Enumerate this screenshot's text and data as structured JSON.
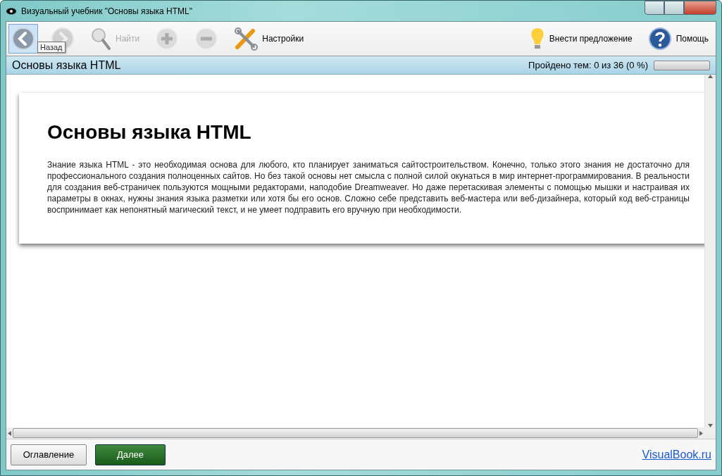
{
  "window": {
    "title": "Визуальный учебник \"Основы языка HTML\""
  },
  "toolbar": [
    {
      "kind": "back",
      "disabled": false,
      "hovered": true,
      "tooltip": "Назад"
    },
    {
      "kind": "forward",
      "disabled": true,
      "hovered": false
    },
    {
      "kind": "find",
      "label": "Найти",
      "disabled": true,
      "hovered": false
    },
    {
      "kind": "zoom-in",
      "disabled": true,
      "hovered": false
    },
    {
      "kind": "zoom-out",
      "disabled": true,
      "hovered": false
    },
    {
      "kind": "settings",
      "label": "Настройки",
      "disabled": false,
      "hovered": false
    },
    {
      "kind": "spacer"
    },
    {
      "kind": "suggest",
      "label": "Внести предложение",
      "disabled": false,
      "hovered": false
    },
    {
      "kind": "help",
      "label": "Помощь",
      "disabled": false,
      "hovered": false
    }
  ],
  "header": {
    "title": "Основы языка HTML",
    "progress_text": "Пройдено тем: 0 из 36 (0 %)",
    "level": 0
  },
  "article": {
    "heading": "Основы языка HTML",
    "paragraph": "Знание языка HTML - это необходимая основа для любого, кто планирует заниматься сайтостроительством. Конечно, только этого знания не достаточно для профессионального создания полноценных сайтов. Но без такой основы нет смысла с полной силой окунаться в мир интернет-программирования. В реальности для создания веб-страничек пользуются мощными редакторами, наподобие Dreamweaver. Но даже перетаскивая элементы с помощью мышки и настраивая их параметры в окнах, нужны знания языка разметки или хотя бы его основ. Сложно себе представить веб-мастера или веб-дизайнера, который код веб-страницы воспринимает как непонятный магический текст, и не умеет подправить его вручную при необходимости."
  },
  "footer": {
    "buttons": [
      {
        "label": "Оглавление",
        "kind": "plain"
      },
      {
        "label": "Далее",
        "kind": "primary"
      }
    ],
    "link": "VisualBook.ru"
  }
}
